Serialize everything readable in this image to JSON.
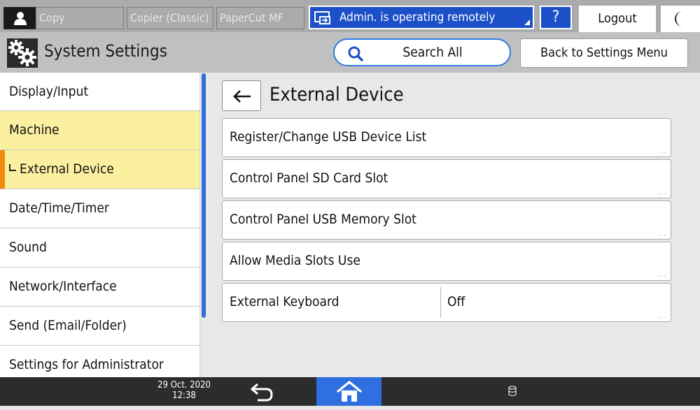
{
  "topbar": {
    "tabs": [
      "Copy",
      "Copier (Classic)",
      "PaperCut MF"
    ],
    "remote_status": "Admin. is operating remotely",
    "help_label": "?",
    "logout_label": "Logout"
  },
  "header": {
    "title": "System Settings",
    "search_label": "Search All",
    "back_menu_label": "Back to Settings Menu"
  },
  "sidebar": {
    "items": [
      {
        "label": "Display/Input"
      },
      {
        "label": "Machine"
      },
      {
        "label": "External Device"
      },
      {
        "label": "Date/Time/Timer"
      },
      {
        "label": "Sound"
      },
      {
        "label": "Network/Interface"
      },
      {
        "label": "Send (Email/Folder)"
      },
      {
        "label": "Settings for Administrator"
      }
    ]
  },
  "main": {
    "title": "External Device",
    "rows": [
      {
        "label": "Register/Change USB Device List"
      },
      {
        "label": "Control Panel SD Card Slot"
      },
      {
        "label": "Control Panel USB Memory Slot"
      },
      {
        "label": "Allow Media Slots Use"
      },
      {
        "label": "External Keyboard",
        "value": "Off"
      }
    ],
    "more_indicator": "..."
  },
  "bottombar": {
    "date": "29 Oct. 2020",
    "time": "12:38"
  },
  "colors": {
    "accent_blue": "#1c50c8",
    "highlight_yellow": "#fbf0a0",
    "selection_orange": "#f08a10",
    "home_blue": "#2f6fe0"
  }
}
